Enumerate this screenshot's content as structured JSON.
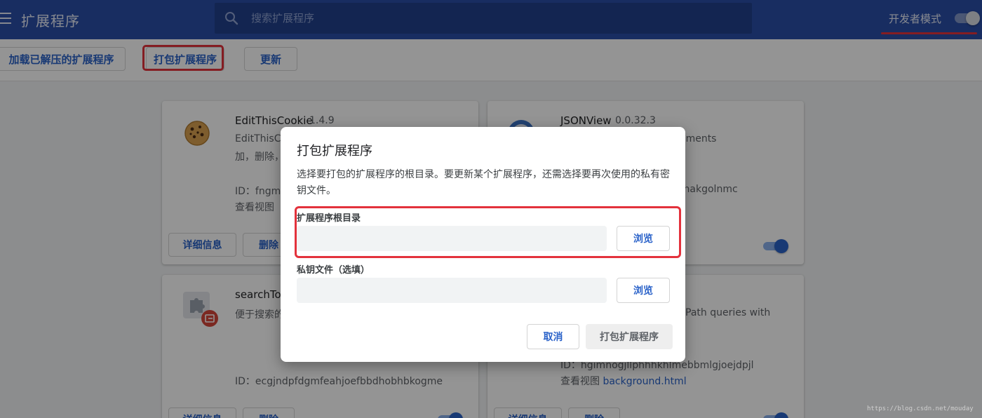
{
  "header": {
    "title": "扩展程序",
    "search_placeholder": "搜索扩展程序",
    "dev_mode_label": "开发者模式",
    "dev_mode_enabled": true,
    "background_color": "#2a4ea8"
  },
  "toolbar": {
    "load_unpacked_label": "加载已解压的扩展程序",
    "pack_label": "打包扩展程序",
    "update_label": "更新"
  },
  "extensions": [
    {
      "name": "EditThisCookie",
      "version": "1.4.9",
      "desc_line1": "EditThisCo",
      "desc_line2": "加，删除，",
      "id_text": "ID：fngml",
      "views_text": "查看视图",
      "icon": "cookie-icon",
      "details_label": "详细信息",
      "remove_label": "删除"
    },
    {
      "name": "JSONView",
      "version": "0.0.32.3",
      "desc_line1": "cuments",
      "id_text": "efhakgolnmc",
      "icon": "jsonview-icon",
      "enabled": true
    },
    {
      "name": "searchToo",
      "desc_line1": "便于搜索的",
      "id_text": "ID：ecgjndpfdgmfeahjoefbbdhobhbkogme",
      "icon": "puzzle-icon",
      "details_label": "详细信息",
      "remove_label": "删除",
      "enabled": true
    },
    {
      "desc_line1": "Path queries with",
      "id_text": "ID：hgimnogjllphhhkhlmebbmlgjoejdpjl",
      "views_prefix": "查看视图",
      "views_link": "background.html",
      "details_label": "详细信息",
      "remove_label": "删除",
      "enabled": true
    }
  ],
  "dialog": {
    "title": "打包扩展程序",
    "description": "选择要打包的扩展程序的根目录。要更新某个扩展程序，还需选择要再次使用的私有密钥文件。",
    "root_dir_label": "扩展程序根目录",
    "root_dir_value": "",
    "key_file_label": "私钥文件（选填）",
    "key_file_value": "",
    "browse_label": "浏览",
    "cancel_label": "取消",
    "pack_label": "打包扩展程序"
  },
  "watermark": "https://blog.csdn.net/mouday",
  "colors": {
    "accent": "#2a62c9",
    "highlight": "#e3323c"
  }
}
